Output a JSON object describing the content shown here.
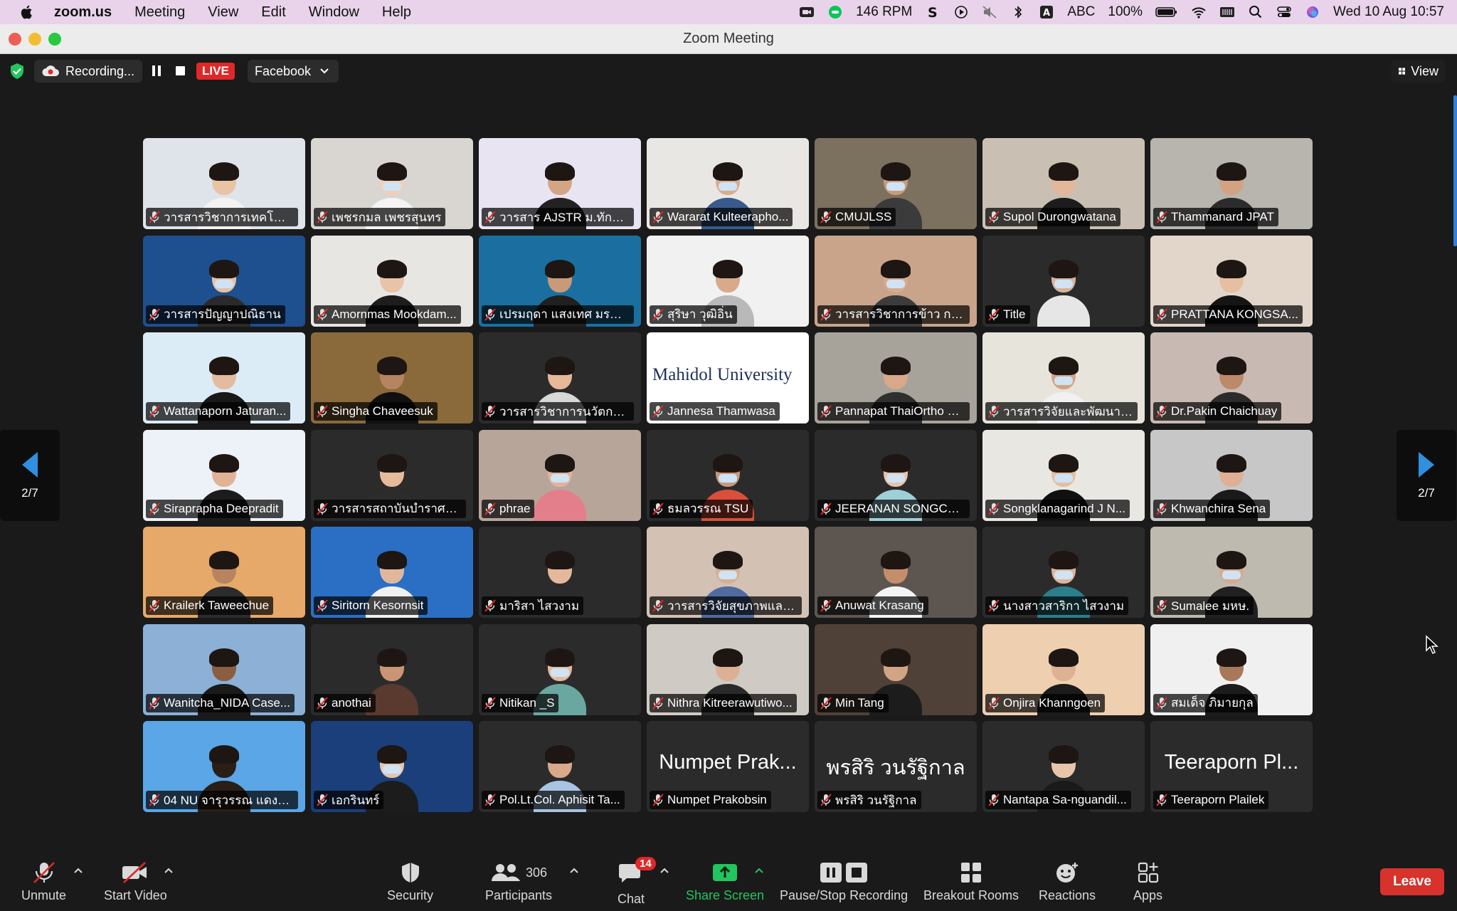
{
  "menubar": {
    "app": "zoom.us",
    "items": [
      "Meeting",
      "View",
      "Edit",
      "Window",
      "Help"
    ],
    "rpm": "146  RPM",
    "input_source": "ABC",
    "battery": "100%",
    "datetime": "Wed 10 Aug  10:57"
  },
  "window": {
    "title": "Zoom Meeting"
  },
  "meeting_bar": {
    "recording_label": "Recording...",
    "live_label": "LIVE",
    "stream_target": "Facebook",
    "view_label": "View"
  },
  "pager": {
    "page": "2/7"
  },
  "participants": [
    {
      "name": "วารสารวิชาการเทคโนโล...",
      "scene": "#dfe3ea",
      "skin": "#e8c3a6",
      "shirt": "#f2f2f2",
      "mask": false
    },
    {
      "name": "เพชรกมล เพชรสุนทร",
      "scene": "#d9d6d1",
      "skin": "#f0d0b8",
      "shirt": "#f4f4f4",
      "mask": true
    },
    {
      "name": "วารสาร AJSTR ม.ทักษิ...",
      "scene": "#e9e4f2",
      "skin": "#d4a585",
      "shirt": "#222222",
      "mask": false
    },
    {
      "name": "Wararat Kulteerapho...",
      "scene": "#e9e7e3",
      "skin": "#d7ad90",
      "shirt": "#3a5a8c",
      "mask": true
    },
    {
      "name": "CMUJLSS",
      "scene": "#7c705f",
      "skin": "#c89b7b",
      "shirt": "#3b3b3b",
      "mask": true
    },
    {
      "name": "Supol Durongwatana",
      "scene": "#c9c0b3",
      "skin": "#e3b79a",
      "shirt": "#1c1c1c",
      "mask": false
    },
    {
      "name": "Thammanard JPAT",
      "scene": "#b8b5ae",
      "skin": "#d2a283",
      "shirt": "#2c2c2c",
      "mask": false
    },
    {
      "name": "วารสารปัญญาปณิธาน",
      "scene": "#1e4f8f",
      "skin": "#e6c0a3",
      "shirt": "#2a2a2a",
      "mask": true
    },
    {
      "name": "Amornmas Mookdam...",
      "scene": "#e8e6e3",
      "skin": "#e7c4a8",
      "shirt": "#1d1d1d",
      "mask": false
    },
    {
      "name": "เปรมฤดา แสงเทศ มรภ....",
      "scene": "#1b6fa0",
      "skin": "#c99a7a",
      "shirt": "#202020",
      "mask": false
    },
    {
      "name": "สุริษา วุฒิอิ่น",
      "scene": "#f1f1f1",
      "skin": "#d9a98c",
      "shirt": "#b9b9b9",
      "mask": false
    },
    {
      "name": "วารสารวิชาการข้าว กรม...",
      "scene": "#c9a48a",
      "skin": "#d8ab8e",
      "shirt": "#3c3c3c",
      "mask": true
    },
    {
      "name": "Title",
      "scene": "#2b2b2b",
      "skin": "#d6b39d",
      "shirt": "#e6e6e6",
      "mask": true
    },
    {
      "name": "PRATTANA KONGSA...",
      "scene": "#e2d6cb",
      "skin": "#e6bea2",
      "shirt": "#151515",
      "mask": false
    },
    {
      "name": "Wattanaporn Jaturan...",
      "scene": "#dcecf6",
      "skin": "#e3bb9f",
      "shirt": "#181818",
      "mask": false,
      "active": true
    },
    {
      "name": "Singha Chaveesuk",
      "scene": "#8a6a3a",
      "skin": "#b58462",
      "shirt": "#101010",
      "mask": false
    },
    {
      "name": "วารสารวิชาการนวัตกรร...",
      "scene": "#2b2b2b",
      "skin": "#e6b898",
      "shirt": "#d8d8d8",
      "mask": false
    },
    {
      "name": "Jannesa Thamwasa",
      "scene": "#ffffff",
      "skin": "#ffffff",
      "shirt": "#ffffff",
      "mask": false,
      "banner": "Mahidol University"
    },
    {
      "name": "Pannapat ThaiOrtho Jou...",
      "scene": "#a8a39a",
      "skin": "#d8a88a",
      "shirt": "#2f2f2f",
      "mask": false
    },
    {
      "name": "วารสารวิจัยและพัฒนา ว...",
      "scene": "#e7e4dc",
      "skin": "#d2a384",
      "shirt": "#f1f1f1",
      "mask": true
    },
    {
      "name": "Dr.Pakin Chaichuay",
      "scene": "#c8b9b2",
      "skin": "#bb8a6a",
      "shirt": "#2b2b2b",
      "mask": false
    },
    {
      "name": "Siraprapha Deepradit",
      "scene": "#edf2f8",
      "skin": "#e1b396",
      "shirt": "#1c1c1c",
      "mask": false
    },
    {
      "name": "วารสารสถาบันบำราศนร...",
      "scene": "#2b2b2b",
      "skin": "#e5bb9c",
      "shirt": "#2c2c2c",
      "mask": false
    },
    {
      "name": "phrae",
      "scene": "#b8a59a",
      "skin": "#e2b39a",
      "shirt": "#e37f8b",
      "mask": true
    },
    {
      "name": "ธมลวรรณ TSU",
      "scene": "#2b2b2b",
      "skin": "#c7997c",
      "shirt": "#d94f3b",
      "mask": true
    },
    {
      "name": "JEERANAN SONGCH...",
      "scene": "#2b2b2b",
      "skin": "#e9c3a8",
      "shirt": "#9fd0d6",
      "mask": true
    },
    {
      "name": "Songklanagarind J N...",
      "scene": "#e9e7e2",
      "skin": "#e5bea2",
      "shirt": "#101010",
      "mask": true,
      "active": true
    },
    {
      "name": "Khwanchira Sena",
      "scene": "#c7c7c7",
      "skin": "#deb095",
      "shirt": "#1a1a1a",
      "mask": false
    },
    {
      "name": "Krailerk Taweechue",
      "scene": "#e6a96a",
      "skin": "#b8845f",
      "shirt": "#2c2c2c",
      "mask": false
    },
    {
      "name": "Siritorn Kesornsit",
      "scene": "#2a6fc3",
      "skin": "#e1b79c",
      "shirt": "#f0f0f0",
      "mask": false
    },
    {
      "name": "มาริสา ไสวงาม",
      "scene": "#2b2b2b",
      "skin": "#e3b89b",
      "shirt": "#2b2b2b",
      "mask": false
    },
    {
      "name": "วารสารวิจัยสุขภาพและก...",
      "scene": "#d3c1b3",
      "skin": "#d9ad90",
      "shirt": "#4f6ba0",
      "mask": true
    },
    {
      "name": "Anuwat Krasang",
      "scene": "#5c5550",
      "skin": "#c48e6c",
      "shirt": "#f4f4f4",
      "mask": false
    },
    {
      "name": "นางสาวสาริกา ไสวงาม",
      "scene": "#2b2b2b",
      "skin": "#e0b497",
      "shirt": "#2b7f8a",
      "mask": true
    },
    {
      "name": "Sumalee มหษ.",
      "scene": "#bfbab0",
      "skin": "#d8aa8d",
      "shirt": "#202020",
      "mask": true
    },
    {
      "name": "Wanitcha_NIDA Case...",
      "scene": "#8cb0d6",
      "skin": "#8b5e42",
      "shirt": "#1a1a1a",
      "mask": false
    },
    {
      "name": "anothai",
      "scene": "#2b2b2b",
      "skin": "#c99575",
      "shirt": "#5a3a2e",
      "mask": false
    },
    {
      "name": "Nitikan _S",
      "scene": "#2b2b2b",
      "skin": "#e4bb9f",
      "shirt": "#6aa7a1",
      "mask": true
    },
    {
      "name": "Nithra Kitreerawutiwo...",
      "scene": "#cfcac3",
      "skin": "#dcb095",
      "shirt": "#2a2a2a",
      "mask": false
    },
    {
      "name": "Min Tang",
      "scene": "#4f4137",
      "skin": "#d2a385",
      "shirt": "#1c1c1c",
      "mask": false
    },
    {
      "name": "Onjira Khanngoen",
      "scene": "#eecfb0",
      "skin": "#deb094",
      "shirt": "#1b1b1b",
      "mask": false
    },
    {
      "name": "สมเด็จ ภิมายกุล",
      "scene": "#f0f0f0",
      "skin": "#a8785a",
      "shirt": "#1c1c1c",
      "mask": false
    },
    {
      "name": "04 NU จารุวรรณ แดงบุ...",
      "scene": "#5aa6e6",
      "skin": "#2a1e18",
      "shirt": "#2a1e18",
      "mask": false
    },
    {
      "name": "เอกรินทร์",
      "scene": "#1a3f7a",
      "skin": "#e8c5ab",
      "shirt": "#1c1c1c",
      "mask": true
    },
    {
      "name": "Pol.Lt.Col. Aphisit Ta...",
      "scene": "#2b2b2b",
      "skin": "#d9a98b",
      "shirt": "#a8c4e2",
      "mask": false
    },
    {
      "name": "Numpet Prakobsin",
      "scene": "#2b2b2b",
      "big": "Numpet Prak..."
    },
    {
      "name": "พรสิริ วนรัฐิกาล",
      "scene": "#2b2b2b",
      "big": "พรสิริ วนรัฐิกาล"
    },
    {
      "name": "Nantapa Sa-nguandil...",
      "scene": "#2b2b2b",
      "skin": "#e8c4aa",
      "shirt": "#1a1a1a",
      "mask": false
    },
    {
      "name": "Teeraporn Plailek",
      "scene": "#2b2b2b",
      "big": "Teeraporn Pl..."
    }
  ],
  "toolbar": {
    "unmute": "Unmute",
    "start_video": "Start Video",
    "security": "Security",
    "participants": "Participants",
    "participants_count": "306",
    "chat": "Chat",
    "chat_badge": "14",
    "share_screen": "Share Screen",
    "pause_stop_recording": "Pause/Stop Recording",
    "breakout_rooms": "Breakout Rooms",
    "reactions": "Reactions",
    "apps": "Apps",
    "leave": "Leave"
  },
  "colors": {
    "accent_green": "#22c55e",
    "leave_red": "#d8322c",
    "live_red": "#e02828",
    "pager_blue": "#2f8fe0",
    "active_speaker": "#e8e25a"
  }
}
